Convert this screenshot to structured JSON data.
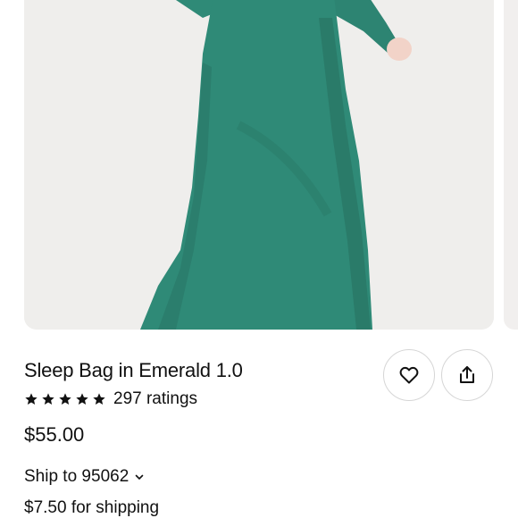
{
  "product": {
    "title": "Sleep Bag in Emerald 1.0",
    "rating_stars": 5,
    "rating_count_label": "297 ratings",
    "price": "$55.00",
    "ship_to_label": "Ship to 95062",
    "shipping_cost_label": "$7.50 for shipping"
  },
  "colors": {
    "product_green": "#2f8a77",
    "text": "#111111",
    "button_border": "#d6d6d6"
  },
  "icons": {
    "favorite": "heart-icon",
    "share": "share-icon",
    "ship_to_dropdown": "chevron-down-icon",
    "rating": "star-icon"
  }
}
